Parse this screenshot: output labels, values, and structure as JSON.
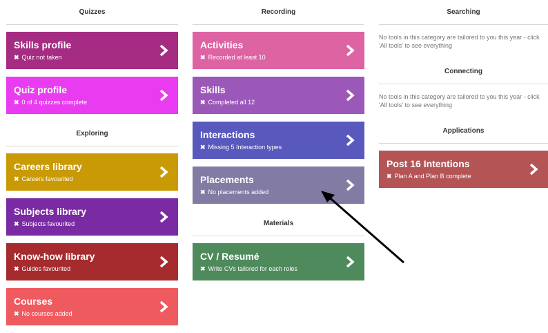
{
  "columns": {
    "col1": {
      "sections": [
        {
          "title": "Quizzes",
          "tiles": [
            {
              "title": "Skills profile",
              "status": "Quiz not taken",
              "color": "#a52c82"
            },
            {
              "title": "Quiz profile",
              "status": "0 of 4 quizzes complete",
              "color": "#e93cf0"
            }
          ]
        },
        {
          "title": "Exploring",
          "tiles": [
            {
              "title": "Careers library",
              "status": "Careers favourited",
              "color": "#c99a06"
            },
            {
              "title": "Subjects library",
              "status": "Subjects favourited",
              "color": "#7a2aa3"
            },
            {
              "title": "Know-how library",
              "status": "Guides favourited",
              "color": "#a52b2e"
            },
            {
              "title": "Courses",
              "status": "No courses added",
              "color": "#ef5a5f"
            }
          ]
        }
      ]
    },
    "col2": {
      "sections": [
        {
          "title": "Recording",
          "tiles": [
            {
              "title": "Activities",
              "status": "Recorded at least 10",
              "color": "#dd63a2"
            },
            {
              "title": "Skills",
              "status": "Completed all 12",
              "color": "#9b58b8"
            },
            {
              "title": "Interactions",
              "status": "Missing 5 Interaction types",
              "color": "#5858bd"
            },
            {
              "title": "Placements",
              "status": "No placements added",
              "color": "#827ba3"
            }
          ]
        },
        {
          "title": "Materials",
          "tiles": [
            {
              "title": "CV / Resumé",
              "status": "Write CVs tailored for each roles",
              "color": "#4e8a5c"
            }
          ]
        }
      ]
    },
    "col3": {
      "searching_title": "Searching",
      "searching_note_line1": "No tools in this category are tailored to you this year - click",
      "searching_note_line2": "'All tools' to see everything",
      "connecting_title": "Connecting",
      "connecting_note_line1": "No tools in this category are tailored to you this year - click",
      "connecting_note_line2": "'All tools' to see everything",
      "applications_title": "Applications",
      "tile": {
        "title": "Post 16 Intentions",
        "status": "Plan A and Plan B complete",
        "color": "#b55455"
      }
    }
  },
  "status_icon": "✖",
  "chevron_icon": "chevron-right-icon",
  "annotation_arrow_color": "#000000"
}
